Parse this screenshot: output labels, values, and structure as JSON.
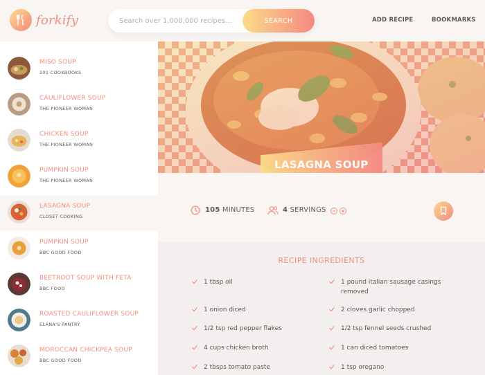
{
  "header": {
    "logo_text": "forkify",
    "search_placeholder": "Search over 1,000,000 recipes...",
    "search_button": "SEARCH",
    "add_recipe": "ADD RECIPE",
    "bookmarks": "BOOKMARKS"
  },
  "results": [
    {
      "title": "MISO SOUP",
      "publisher": "101 COOKBOOKS"
    },
    {
      "title": "CAULIFLOWER SOUP",
      "publisher": "THE PIONEER WOMAN"
    },
    {
      "title": "CHICKEN SOUP",
      "publisher": "THE PIONEER WOMAN"
    },
    {
      "title": "PUMPKIN SOUP",
      "publisher": "THE PIONEER WOMAN"
    },
    {
      "title": "LASAGNA SOUP",
      "publisher": "CLOSET COOKING"
    },
    {
      "title": "PUMPKIN SOUP",
      "publisher": "BBC GOOD FOOD"
    },
    {
      "title": "BEETROOT SOUP WITH FETA",
      "publisher": "BBC FOOD"
    },
    {
      "title": "ROASTED CAULIFLOWER SOUP",
      "publisher": "ELANA'S PANTRY"
    },
    {
      "title": "MOROCCAN CHICKPEA SOUP",
      "publisher": "BBC GOOD FOOD"
    }
  ],
  "recipe": {
    "title": "LASAGNA SOUP",
    "minutes": "105",
    "minutes_label": "MINUTES",
    "servings": "4",
    "servings_label": "SERVINGS",
    "ingredients_heading": "RECIPE INGREDIENTS",
    "ingredients": [
      "1 tbsp oil",
      "1 pound italian sausage casings removed",
      "1 onion diced",
      "2 cloves garlic chopped",
      "1/2 tsp red pepper flakes",
      "1/2 tsp fennel seeds crushed",
      "4 cups chicken broth",
      "1 can diced tomatoes",
      "2 tbsps tomato paste",
      "1 tsp oregano"
    ]
  },
  "colors": {
    "accent": "#f38e82",
    "gradient_start": "#fbdb89",
    "gradient_end": "#f48982",
    "text": "#615551"
  }
}
